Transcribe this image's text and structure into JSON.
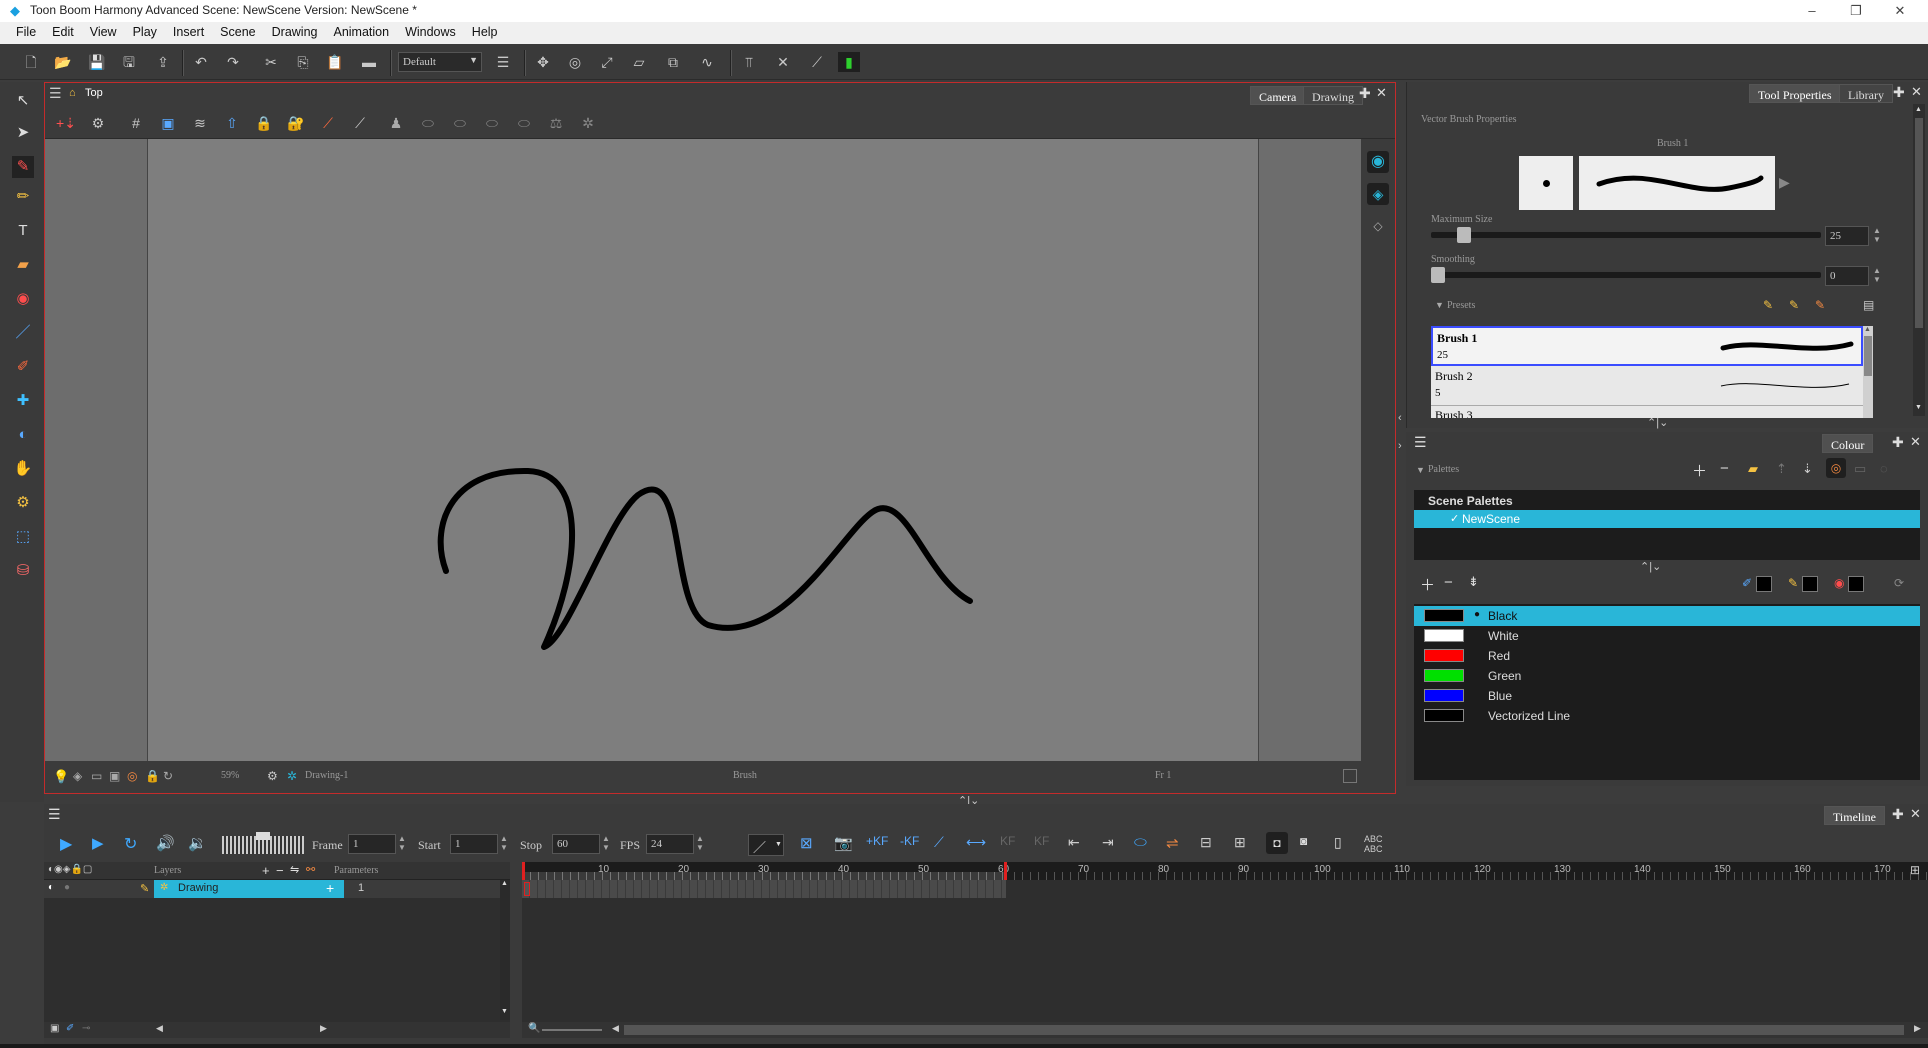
{
  "window": {
    "title": "Toon Boom Harmony Advanced Scene: NewScene Version: NewScene *",
    "controls": [
      "–",
      "❐",
      "✕"
    ]
  },
  "menu": [
    "File",
    "Edit",
    "View",
    "Play",
    "Insert",
    "Scene",
    "Drawing",
    "Animation",
    "Windows",
    "Help"
  ],
  "toolbar": {
    "workspace": "Default"
  },
  "camera": {
    "view_label": "Top",
    "tabs": [
      "Camera",
      "Drawing"
    ],
    "status": {
      "zoom": "59%",
      "drawing": "Drawing-1",
      "tool": "Brush",
      "frame": "Fr 1"
    }
  },
  "tool_properties": {
    "tabs": [
      "Tool Properties",
      "Library"
    ],
    "section": "Vector Brush Properties",
    "brush_name": "Brush 1",
    "max_size_label": "Maximum Size",
    "max_size_value": "25",
    "max_size_fraction": 0.07,
    "smoothing_label": "Smoothing",
    "smoothing_value": "0",
    "smoothing_fraction": 0,
    "presets_label": "Presets",
    "presets": [
      {
        "name": "Brush 1",
        "size": "25",
        "selected": true
      },
      {
        "name": "Brush 2",
        "size": "5",
        "selected": false
      },
      {
        "name": "Brush 3",
        "size": "",
        "selected": false
      }
    ]
  },
  "colour": {
    "tab": "Colour",
    "palettes_label": "Palettes",
    "scene_palettes": "Scene Palettes",
    "palette_name": "NewScene",
    "swatches": [
      {
        "name": "Black",
        "color": "#000000",
        "selected": true
      },
      {
        "name": "White",
        "color": "#ffffff",
        "selected": false
      },
      {
        "name": "Red",
        "color": "#ff0000",
        "selected": false
      },
      {
        "name": "Green",
        "color": "#00e000",
        "selected": false
      },
      {
        "name": "Blue",
        "color": "#0000ff",
        "selected": false
      },
      {
        "name": "Vectorized Line",
        "color": "#000000",
        "selected": false
      }
    ]
  },
  "timeline": {
    "tab": "Timeline",
    "frame_label": "Frame",
    "frame_value": "1",
    "start_label": "Start",
    "start_value": "1",
    "stop_label": "Stop",
    "stop_value": "60",
    "fps_label": "FPS",
    "fps_value": "24",
    "layers_label": "Layers",
    "parameters_label": "Parameters",
    "layer_name": "Drawing",
    "layer_param": "1",
    "ruler": [
      "10",
      "20",
      "30",
      "40",
      "50",
      "60",
      "70",
      "80",
      "90",
      "100",
      "110",
      "120",
      "130",
      "140",
      "150",
      "160",
      "170"
    ],
    "abc_label": "ABC ABC"
  },
  "accent_colors": {
    "selection_blue": "#29b6d8",
    "panel_border_red": "#c42b2b",
    "playhead_red": "#e02020"
  }
}
